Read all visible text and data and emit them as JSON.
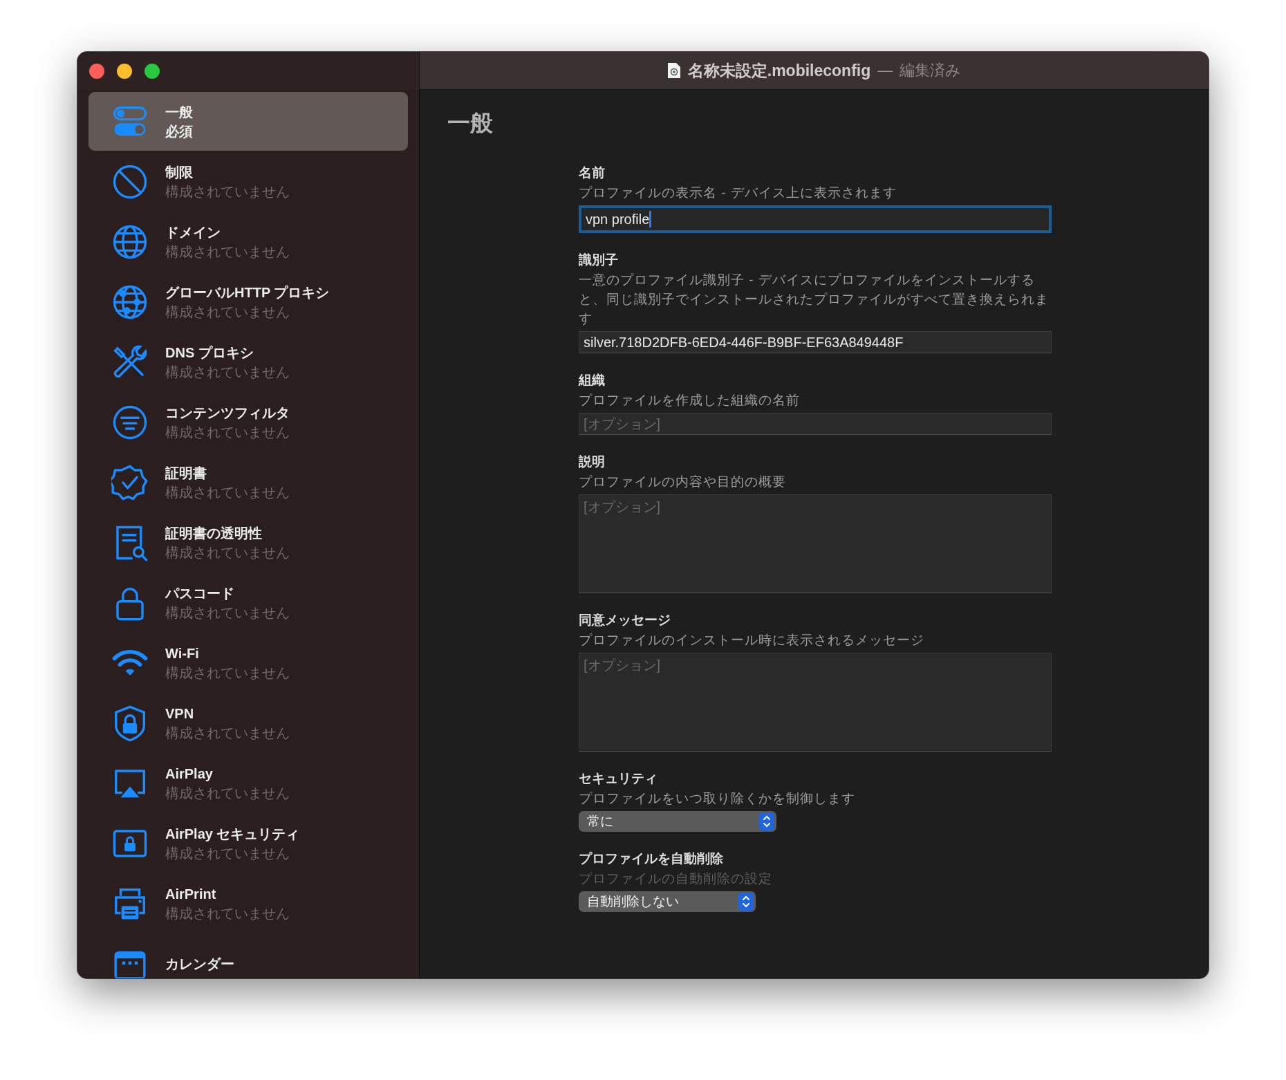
{
  "window": {
    "title": "名称未設定.mobileconfig",
    "separator": "—",
    "status": "編集済み"
  },
  "sidebar": {
    "items": [
      {
        "title": "一般",
        "subtitle": "必須",
        "selected": true
      },
      {
        "title": "制限",
        "subtitle": "構成されていません",
        "selected": false
      },
      {
        "title": "ドメイン",
        "subtitle": "構成されていません",
        "selected": false
      },
      {
        "title": "グローバルHTTP プロキシ",
        "subtitle": "構成されていません",
        "selected": false
      },
      {
        "title": "DNS プロキシ",
        "subtitle": "構成されていません",
        "selected": false
      },
      {
        "title": "コンテンツフィルタ",
        "subtitle": "構成されていません",
        "selected": false
      },
      {
        "title": "証明書",
        "subtitle": "構成されていません",
        "selected": false
      },
      {
        "title": "証明書の透明性",
        "subtitle": "構成されていません",
        "selected": false
      },
      {
        "title": "パスコード",
        "subtitle": "構成されていません",
        "selected": false
      },
      {
        "title": "Wi-Fi",
        "subtitle": "構成されていません",
        "selected": false
      },
      {
        "title": "VPN",
        "subtitle": "構成されていません",
        "selected": false
      },
      {
        "title": "AirPlay",
        "subtitle": "構成されていません",
        "selected": false
      },
      {
        "title": "AirPlay セキュリティ",
        "subtitle": "構成されていません",
        "selected": false
      },
      {
        "title": "AirPrint",
        "subtitle": "構成されていません",
        "selected": false
      },
      {
        "title": "カレンダー",
        "selected": false
      }
    ]
  },
  "content": {
    "heading": "一般",
    "fields": [
      {
        "kind": "text",
        "label": "名前",
        "hint": "プロファイルの表示名 - デバイス上に表示されます",
        "value": "vpn profile",
        "focused": true,
        "hint_disabled": false
      },
      {
        "kind": "text",
        "label": "識別子",
        "hint": "一意のプロファイル識別子 - デバイスにプロファイルをインストールすると、同じ識別子でインストールされたプロファイルがすべて置き換えられます",
        "value": "silver.718D2DFB-6ED4-446F-B9BF-EF63A849448F",
        "focused": false,
        "hint_disabled": false
      },
      {
        "kind": "text",
        "label": "組織",
        "hint": "プロファイルを作成した組織の名前",
        "placeholder": "[オプション]",
        "focused": false,
        "hint_disabled": false
      },
      {
        "kind": "textarea",
        "label": "説明",
        "hint": "プロファイルの内容や目的の概要",
        "placeholder": "[オプション]",
        "focused": false,
        "hint_disabled": false
      },
      {
        "kind": "textarea",
        "label": "同意メッセージ",
        "hint": "プロファイルのインストール時に表示されるメッセージ",
        "placeholder": "[オプション]",
        "focused": false,
        "hint_disabled": false
      },
      {
        "kind": "select",
        "label": "セキュリティ",
        "hint": "プロファイルをいつ取り除くかを制御します",
        "value": "常に",
        "focused": false,
        "hint_disabled": false
      },
      {
        "kind": "select",
        "label": "プロファイルを自動削除",
        "hint": "プロファイルの自動削除の設定",
        "value": "自動削除しない",
        "focused": false,
        "hint_disabled": true
      }
    ]
  }
}
